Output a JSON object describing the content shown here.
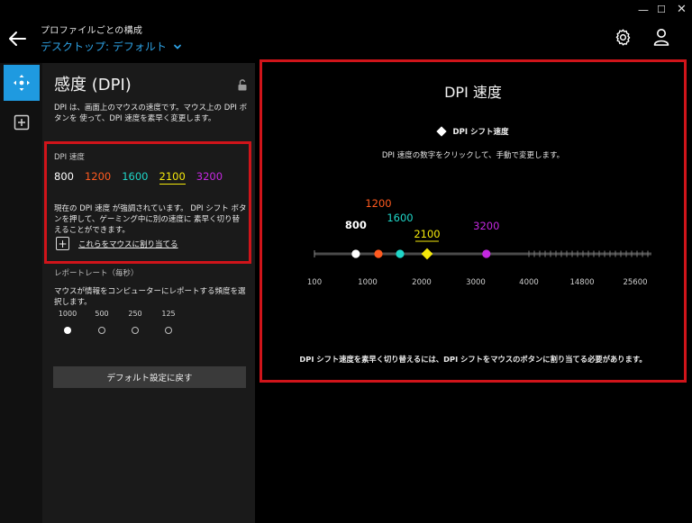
{
  "window": {
    "minimize_glyph": "—",
    "maximize_glyph": "☐",
    "close_glyph": "✕"
  },
  "header": {
    "subtitle": "プロファイルごとの構成",
    "title": "デスクトップ: デフォルト",
    "title_color": "#2ea3e6"
  },
  "rail": {
    "items": [
      {
        "icon": "dpi-move-icon",
        "active": true
      },
      {
        "icon": "add-square-icon",
        "active": false
      }
    ],
    "active_color": "#1f9ae0"
  },
  "panel": {
    "title": "感度 (DPI)",
    "description": "DPI は、画面上のマウスの速度です。マウス上の DPI ボタンを 使って、DPI 速度を素早く変更します。",
    "dpi_section": {
      "label": "DPI 速度",
      "values": [
        {
          "text": "800",
          "color": "#ffffff",
          "selected": false
        },
        {
          "text": "1200",
          "color": "#ff5a1f",
          "selected": false
        },
        {
          "text": "1600",
          "color": "#1fd6c8",
          "selected": false
        },
        {
          "text": "2100",
          "color": "#f4e80b",
          "selected": true
        },
        {
          "text": "3200",
          "color": "#c428e0",
          "selected": false
        }
      ],
      "note": "現在の DPI 速度 が強調されています。 DPI シフト ボタンを押して、ゲーミング中に別の速度に 素早く切り替えることができます。",
      "assign_plus": "+",
      "assign_link": "これらをマウスに割り当てる"
    },
    "report_rate": {
      "label": "レポートレート（毎秒）",
      "description": "マウスが情報をコンピューターにレポートする頻度を選択します。",
      "options": [
        {
          "label": "1000",
          "selected": true
        },
        {
          "label": "500",
          "selected": false
        },
        {
          "label": "250",
          "selected": false
        },
        {
          "label": "125",
          "selected": false
        }
      ]
    },
    "reset_label": "デフォルト設定に戻す"
  },
  "viz": {
    "title": "DPI 速度",
    "legend_label": "DPI シフト速度",
    "instruction": "DPI 速度の数字をクリックして、手動で変更します。",
    "footer": "DPI シフト速度を素早く切り替えるには、DPI シフトをマウスのボタンに割り当てる必要があります。",
    "accent_border": "#d0141a"
  },
  "chart_data": {
    "type": "scatter",
    "scale": "piecewise",
    "axis_ticks": [
      100,
      1000,
      2000,
      3000,
      4000,
      14800,
      25600
    ],
    "xlim": [
      100,
      25600
    ],
    "points": [
      {
        "value": 800,
        "label": "800",
        "color": "#ffffff",
        "marker": "circle"
      },
      {
        "value": 1200,
        "label": "1200",
        "color": "#ff5a1f",
        "marker": "circle"
      },
      {
        "value": 1600,
        "label": "1600",
        "color": "#1fd6c8",
        "marker": "circle"
      },
      {
        "value": 2100,
        "label": "2100",
        "color": "#f4e80b",
        "marker": "diamond",
        "shift": true
      },
      {
        "value": 3200,
        "label": "3200",
        "color": "#c428e0",
        "marker": "circle"
      }
    ]
  }
}
